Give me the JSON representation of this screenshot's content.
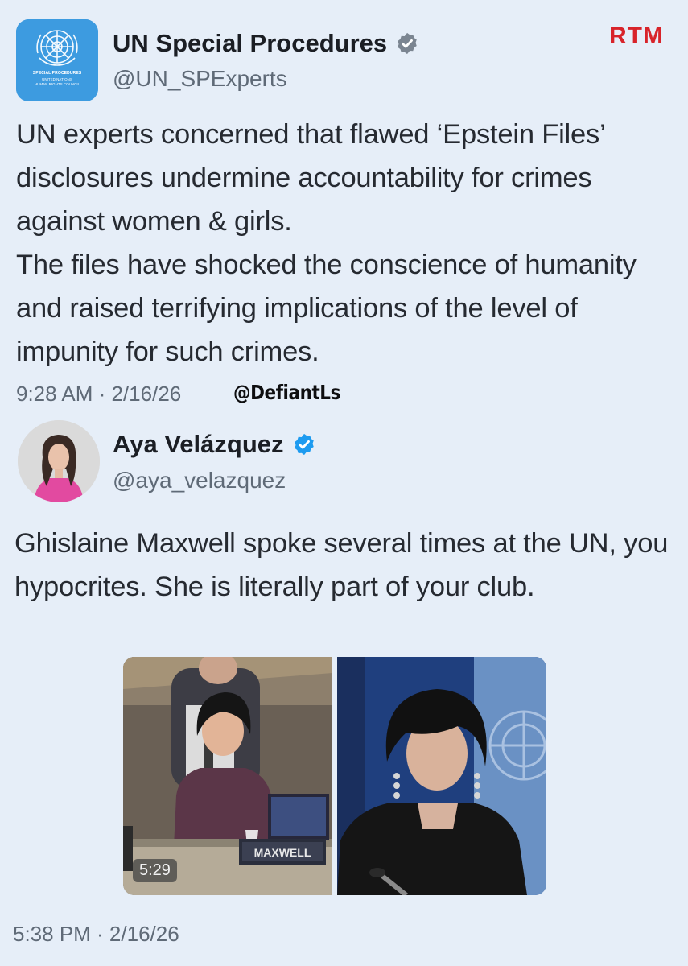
{
  "tweet1": {
    "author_name": "UN Special Procedures",
    "author_handle": "@UN_SPExperts",
    "avatar_caption_line1": "SPECIAL PROCEDURES",
    "avatar_caption_line2": "UNITED NATIONS",
    "avatar_caption_line3": "HUMAN RIGHTS COUNCIL",
    "text_paragraph_1": "UN experts concerned that flawed ‘Epstein Files’ disclosures undermine accountability for crimes against women & girls.",
    "text_paragraph_2": "The files have shocked the conscience of humanity and raised terrifying implications of the level of impunity for such crimes.",
    "timestamp": "9:28 AM · 2/16/26"
  },
  "brand_logo": "RTM",
  "watermark": "@DefiantLs",
  "tweet2": {
    "author_name": "Aya Velázquez",
    "author_handle": "@aya_velazquez",
    "text": "Ghislaine Maxwell spoke several times at the UN, you hypocrites. She is literally part of your club.",
    "media": {
      "video_duration": "5:29",
      "nameplate": "MAXWELL"
    },
    "timestamp": "5:38 PM · 2/16/26"
  },
  "icons": {
    "verified_badge_tweet1": "verified-badge-gray-icon",
    "verified_badge_tweet2": "verified-badge-blue-icon"
  },
  "colors": {
    "background": "#e6eef8",
    "un_blue": "#3d9be0",
    "verified_gray": "#7b8591",
    "verified_blue": "#1d9bf0",
    "rtm_red": "#d8232a"
  }
}
